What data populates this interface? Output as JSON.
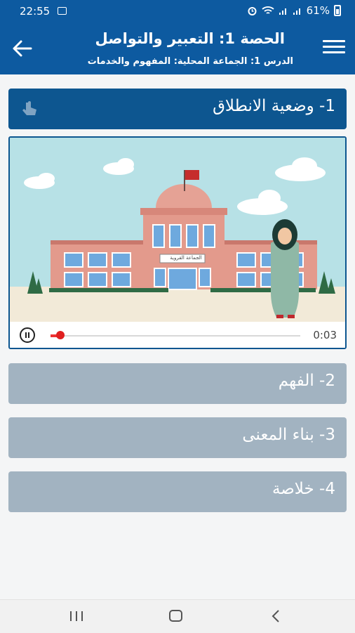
{
  "status_bar": {
    "time": "22:55",
    "battery_text": "61%",
    "icons": [
      "image-icon",
      "alarm-icon",
      "wifi-icon",
      "signal-icon",
      "signal-icon",
      "battery-icon"
    ]
  },
  "header": {
    "title": "الحصة 1: التعبير والتواصل",
    "subtitle": "الدرس 1: الجماعة المحلية: المفهوم والخدمات",
    "back_icon": "arrow-left-icon",
    "menu_icon": "hamburger-menu-icon"
  },
  "sections": [
    {
      "label": "1- وضعية الانطلاق",
      "expanded": true,
      "icon": "touch-gesture-icon"
    },
    {
      "label": "2- الفهم",
      "expanded": false
    },
    {
      "label": "3- بناء المعنى",
      "expanded": false
    },
    {
      "label": "4- خلاصة",
      "expanded": false
    }
  ],
  "media": {
    "building_sign": "الجماعة القروية",
    "audio": {
      "current_time": "0:03",
      "progress_fraction": 0.04
    }
  },
  "colors": {
    "primary": "#0d5aa0",
    "section_active": "#0d5690",
    "section_collapsed": "#a2b3c1",
    "progress": "#e02020"
  }
}
